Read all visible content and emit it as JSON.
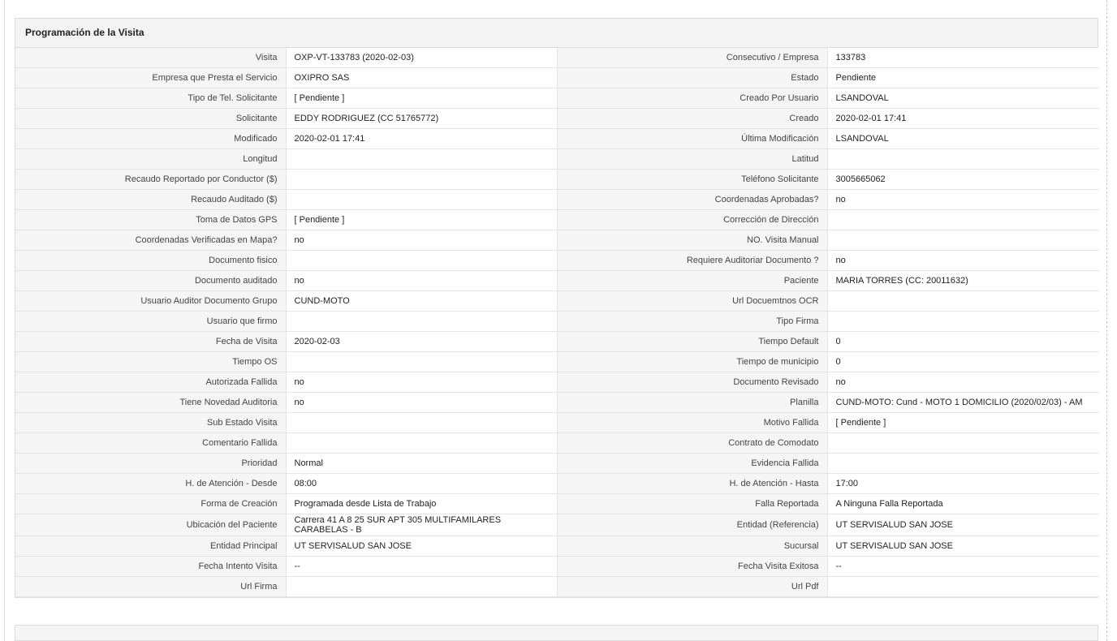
{
  "section": {
    "title": "Programación de la Visita"
  },
  "rows": [
    {
      "l1": "Visita",
      "v1": "OXP-VT-133783 (2020-02-03)",
      "l2": "Consecutivo / Empresa",
      "v2": "133783"
    },
    {
      "l1": "Empresa que Presta el Servicio",
      "v1": "OXIPRO SAS",
      "l2": "Estado",
      "v2": "Pendiente"
    },
    {
      "l1": "Tipo de Tel. Solicitante",
      "v1": "[ Pendiente ]",
      "l2": "Creado Por Usuario",
      "v2": "LSANDOVAL"
    },
    {
      "l1": "Solicitante",
      "v1": "EDDY RODRIGUEZ (CC 51765772)",
      "l2": "Creado",
      "v2": "2020-02-01 17:41"
    },
    {
      "l1": "Modificado",
      "v1": "2020-02-01 17:41",
      "l2": "Última Modificación",
      "v2": " LSANDOVAL"
    },
    {
      "l1": "Longitud",
      "v1": "",
      "l2": "Latitud",
      "v2": ""
    },
    {
      "l1": "Recaudo Reportado por Conductor ($)",
      "v1": "",
      "l2": "Teléfono Solicitante",
      "v2": "3005665062"
    },
    {
      "l1": "Recaudo Auditado ($)",
      "v1": "",
      "l2": "Coordenadas Aprobadas?",
      "v2": " no"
    },
    {
      "l1": "Toma de Datos GPS",
      "v1": "[ Pendiente ]",
      "l2": "Corrección de Dirección",
      "v2": ""
    },
    {
      "l1": "Coordenadas Verificadas en Mapa?",
      "v1": " no",
      "l2": "NO. Visita Manual",
      "v2": ""
    },
    {
      "l1": "Documento fisico",
      "v1": "",
      "l2": "Requiere Auditoriar Documento ?",
      "v2": " no"
    },
    {
      "l1": "Documento auditado",
      "v1": " no",
      "l2": "Paciente",
      "v2": "MARIA TORRES (CC: 20011632)"
    },
    {
      "l1": "Usuario Auditor Documento Grupo",
      "v1": "CUND-MOTO",
      "l2": "Url Docuemtnos OCR",
      "v2": ""
    },
    {
      "l1": "Usuario que firmo",
      "v1": "",
      "l2": "Tipo Firma",
      "v2": ""
    },
    {
      "l1": "Fecha de Visita",
      "v1": " 2020-02-03",
      "l2": "Tiempo Default",
      "v2": "0"
    },
    {
      "l1": "Tiempo OS",
      "v1": "",
      "l2": "Tiempo de municipio",
      "v2": "0"
    },
    {
      "l1": "Autorizada Fallida",
      "v1": " no",
      "l2": "Documento Revisado",
      "v2": " no"
    },
    {
      "l1": "Tiene Novedad Auditoria",
      "v1": " no",
      "l2": "Planilla",
      "v2": "CUND-MOTO: Cund - MOTO 1 DOMICILIO (2020/02/03) - AM"
    },
    {
      "l1": "Sub Estado Visita",
      "v1": "",
      "l2": "Motivo Fallida",
      "v2": "[ Pendiente ]"
    },
    {
      "l1": "Comentario Fallida",
      "v1": "",
      "l2": "Contrato de Comodato",
      "v2": ""
    },
    {
      "l1": "Prioridad",
      "v1": "Normal",
      "l2": "Evidencia Fallida",
      "v2": ""
    },
    {
      "l1": "H. de Atención - Desde",
      "v1": "08:00",
      "l2": "H. de Atención - Hasta",
      "v2": "17:00"
    },
    {
      "l1": "Forma de Creación",
      "v1": "Programada desde Lista de Trabajo",
      "l2": "Falla Reportada",
      "v2": "A Ninguna Falla Reportada"
    },
    {
      "l1": "Ubicación del Paciente",
      "v1": "Carrera 41 A 8 25 SUR APT 305 MULTIFAMILARES CARABELAS - B",
      "l2": "Entidad (Referencia)",
      "v2": "UT SERVISALUD SAN JOSE"
    },
    {
      "l1": "Entidad Principal",
      "v1": "UT SERVISALUD SAN JOSE",
      "l2": "Sucursal",
      "v2": "UT SERVISALUD SAN JOSE"
    },
    {
      "l1": "Fecha Intento Visita",
      "v1": " --",
      "l2": "Fecha Visita Exitosa",
      "v2": " --"
    },
    {
      "l1": "Url Firma",
      "v1": "",
      "l2": "Url Pdf",
      "v2": ""
    }
  ]
}
